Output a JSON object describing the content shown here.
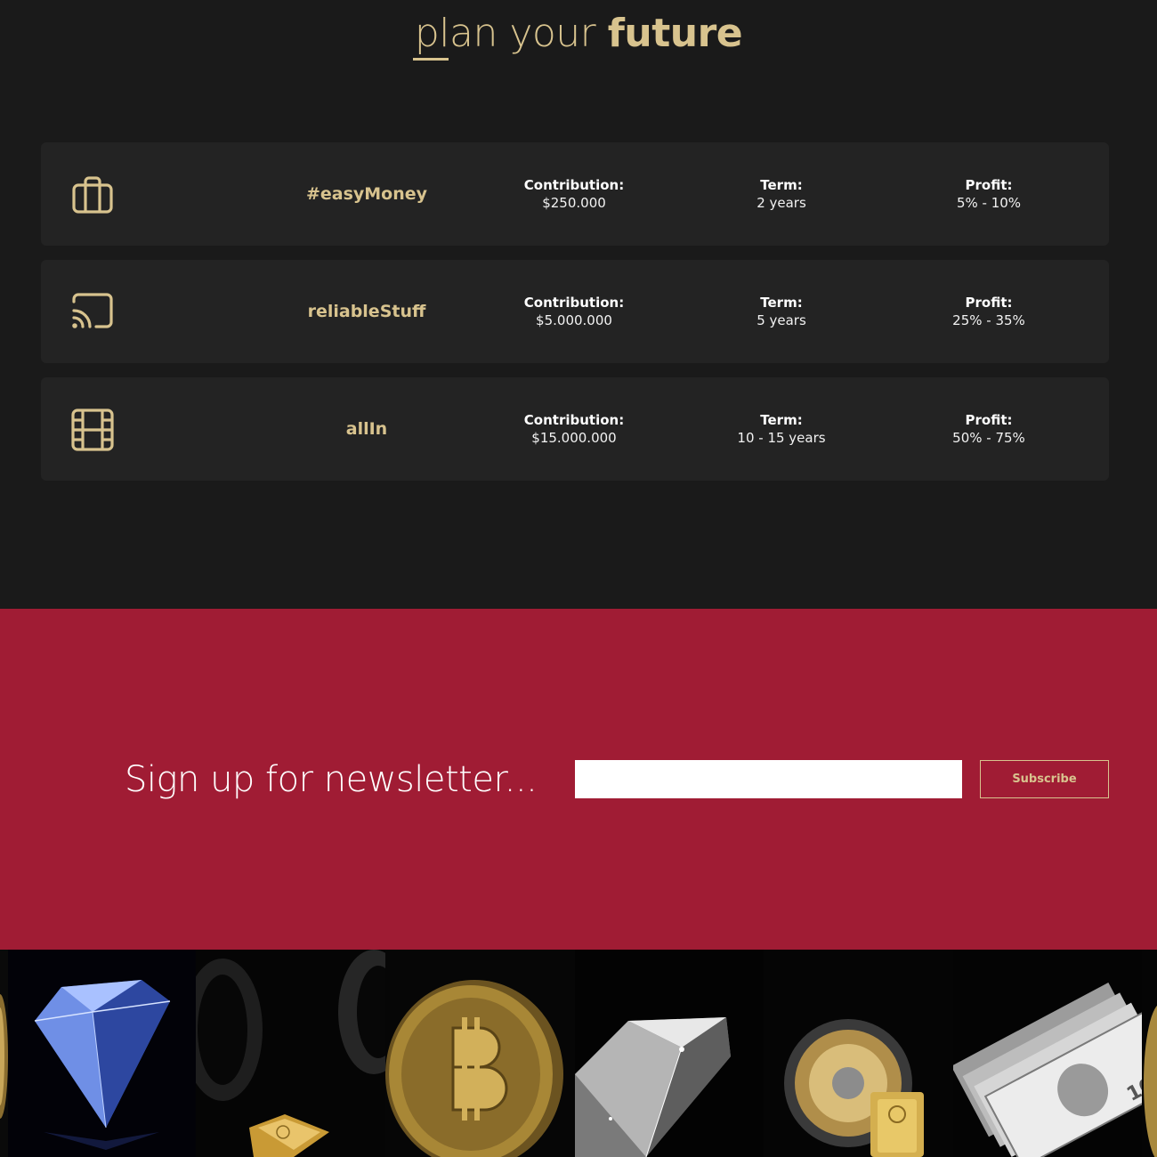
{
  "header": {
    "title_light": "plan your",
    "title_bold": "future"
  },
  "plans": [
    {
      "icon": "briefcase-icon",
      "name": "#easyMoney",
      "contribution_label": "Contribution:",
      "contribution_value": "$250.000",
      "term_label": "Term:",
      "term_value": "2 years",
      "profit_label": "Profit:",
      "profit_value": "5% - 10%"
    },
    {
      "icon": "cast-icon",
      "name": "reliableStuff",
      "contribution_label": "Contribution:",
      "contribution_value": "$5.000.000",
      "term_label": "Term:",
      "term_value": "5 years",
      "profit_label": "Profit:",
      "profit_value": "25% - 35%"
    },
    {
      "icon": "film-icon",
      "name": "allIn",
      "contribution_label": "Contribution:",
      "contribution_value": "$15.000.000",
      "term_label": "Term:",
      "term_value": "10 - 15 years",
      "profit_label": "Profit:",
      "profit_value": "50% - 75%"
    }
  ],
  "newsletter": {
    "heading": "Sign up for newsletter...",
    "email_value": "",
    "email_placeholder": "",
    "subscribe_label": "Subscribe"
  },
  "gallery": {
    "items": [
      "gold-coin-image",
      "blue-diamond-image",
      "gold-bar-and-ring-image",
      "bitcoin-coin-image",
      "clear-diamond-image",
      "gold-bar-and-watch-image",
      "dollar-bills-image",
      "gold-coin-image"
    ]
  },
  "colors": {
    "background": "#1a1a1a",
    "card": "#232323",
    "gold_accent": "#d8c38e",
    "newsletter_red": "#a01c34",
    "white": "#ffffff"
  }
}
